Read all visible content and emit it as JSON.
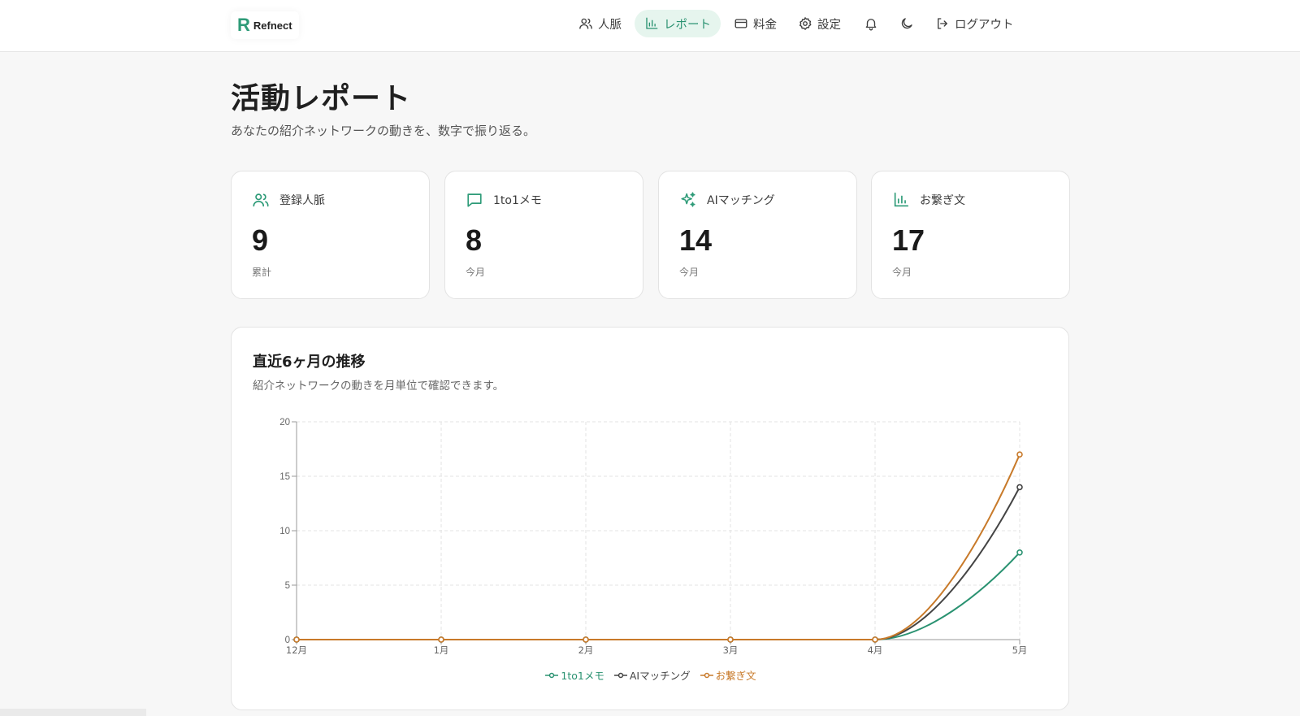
{
  "brand": {
    "mark": "R",
    "name": "Refnect"
  },
  "nav": {
    "people": "人脈",
    "report": "レポート",
    "pricing": "料金",
    "settings": "設定",
    "logout": "ログアウト"
  },
  "page": {
    "title": "活動レポート",
    "subtitle": "あなたの紹介ネットワークの動きを、数字で振り返る。"
  },
  "stats": [
    {
      "label": "登録人脈",
      "value": "9",
      "sub": "累計",
      "icon": "users-icon"
    },
    {
      "label": "1to1メモ",
      "value": "8",
      "sub": "今月",
      "icon": "message-icon"
    },
    {
      "label": "AIマッチング",
      "value": "14",
      "sub": "今月",
      "icon": "sparkles-icon"
    },
    {
      "label": "お繋ぎ文",
      "value": "17",
      "sub": "今月",
      "icon": "bar-chart-icon"
    }
  ],
  "chart_section": {
    "title": "直近6ヶ月の推移",
    "subtitle": "紹介ネットワークの動きを月単位で確認できます。"
  },
  "colors": {
    "accent": "#2e9b78",
    "active_bg": "#e6f5ee",
    "series_memo": "#2a9271",
    "series_ai": "#444444",
    "series_intro": "#c87a2a"
  },
  "chart_data": {
    "type": "line",
    "categories": [
      "12月",
      "1月",
      "2月",
      "3月",
      "4月",
      "5月"
    ],
    "series": [
      {
        "name": "1to1メモ",
        "values": [
          0,
          0,
          0,
          0,
          0,
          8
        ],
        "color": "#2a9271"
      },
      {
        "name": "AIマッチング",
        "values": [
          0,
          0,
          0,
          0,
          0,
          14
        ],
        "color": "#444444"
      },
      {
        "name": "お繋ぎ文",
        "values": [
          0,
          0,
          0,
          0,
          0,
          17
        ],
        "color": "#c87a2a"
      }
    ],
    "yticks": [
      "0",
      "5",
      "10",
      "15",
      "20"
    ],
    "ylim": [
      0,
      20
    ],
    "grid": true,
    "legend": "bottom-center"
  }
}
